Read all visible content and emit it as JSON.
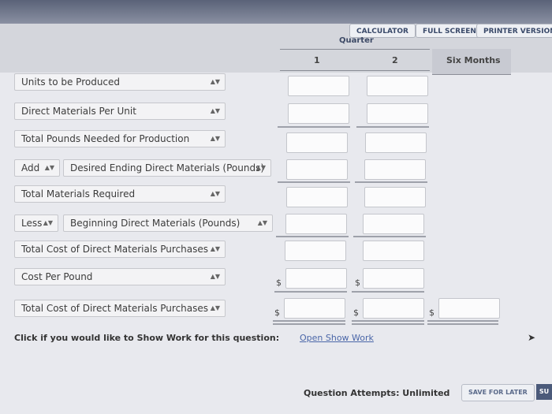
{
  "toolbar": {
    "calculator": "CALCULATOR",
    "full_screen": "FULL SCREEN",
    "printer_version": "PRINTER VERSION"
  },
  "table": {
    "quarter_label": "Quarter",
    "columns": [
      "1",
      "2",
      "Six Months"
    ],
    "rows": [
      {
        "label": "Units to be Produced"
      },
      {
        "label": "Direct Materials Per Unit"
      },
      {
        "label": "Total Pounds Needed for Production"
      },
      {
        "prefix": "Add",
        "label": "Desired Ending Direct Materials (Pounds)"
      },
      {
        "label": "Total Materials Required"
      },
      {
        "prefix": "Less",
        "label": "Beginning Direct Materials (Pounds)"
      },
      {
        "label": "Total Cost of Direct Materials Purchases"
      },
      {
        "label": "Cost Per Pound"
      },
      {
        "label": "Total Cost of Direct Materials Purchases"
      }
    ],
    "currency_symbol": "$"
  },
  "show_work": {
    "prompt": "Click if you would like to Show Work for this question:",
    "link": "Open Show Work"
  },
  "footer": {
    "attempts": "Question Attempts: Unlimited",
    "save_later": "SAVE FOR LATER",
    "submit": "SU"
  }
}
